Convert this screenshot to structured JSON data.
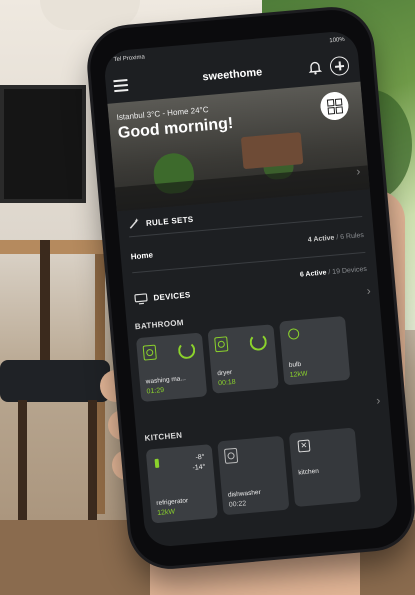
{
  "colors": {
    "accent": "#8bd22c",
    "screen_bg": "#1d1f22",
    "card_bg": "#35383c"
  },
  "status": {
    "carrier": "Tel Proxima",
    "battery": "100%"
  },
  "app": {
    "title": "sweethome"
  },
  "hero": {
    "weather": "Istanbul 3°C - Home 24°C",
    "greeting": "Good morning!"
  },
  "rule_sets": {
    "label": "RULE SETS",
    "rows": [
      {
        "name": "Home",
        "active": "4 Active",
        "total": "/ 6 Rules"
      }
    ]
  },
  "devices": {
    "label": "DEVICES",
    "summary_active": "6 Active",
    "summary_total": "/ 19 Devices",
    "rooms": [
      {
        "name": "BATHROOM",
        "cards": [
          {
            "name": "washing ma...",
            "value": "01:29",
            "icon": "washer-icon"
          },
          {
            "name": "dryer",
            "value": "00:18",
            "icon": "dryer-icon"
          },
          {
            "name": "bulb",
            "value": "12kW",
            "icon": "bulb-icon"
          }
        ]
      },
      {
        "name": "KITCHEN",
        "cards": [
          {
            "name": "refrigerator",
            "value": "12kW",
            "temp1": "-8°",
            "temp2": "-14°",
            "icon": "refrigerator-icon"
          },
          {
            "name": "dishwasher",
            "value": "00:22",
            "icon": "dishwasher-icon"
          },
          {
            "name": "kitchen",
            "value": "",
            "icon": "close-box-icon"
          }
        ]
      }
    ]
  }
}
